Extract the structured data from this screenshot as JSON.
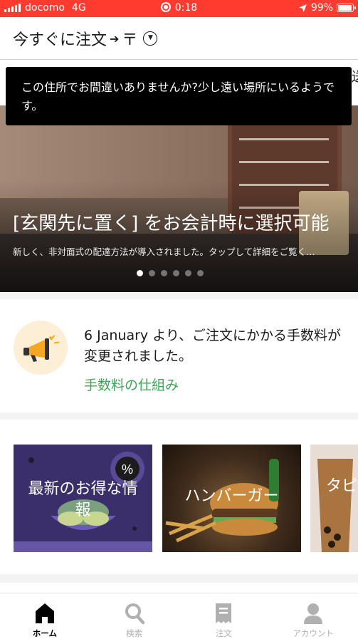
{
  "status_bar": {
    "carrier": "docomo",
    "network": "4G",
    "time": "0:18",
    "battery_percent": "99%",
    "battery_level": 0.99,
    "color": "#ff3b30"
  },
  "header": {
    "order_timing": "今すぐに注文",
    "address_initial": "〒",
    "dropdown_icon": "chevron-down-icon"
  },
  "tooltip": {
    "message": "この住所でお間違いありませんか?少し遠い場所にいるようです。",
    "partial_text_edge": "送"
  },
  "hero": {
    "title": "[玄関先に置く] をお会計時に選択可能",
    "subtitle": "新しく、非対面式の配達方法が導入されました。タップして詳細をご覧く…",
    "slide_count": 6,
    "active_slide": 1
  },
  "notice": {
    "icon": "megaphone-icon",
    "text": "6 January より、ご注文にかかる手数料が変更されました。",
    "link": "手数料の仕組み",
    "link_color": "#3aa757"
  },
  "categories": [
    {
      "label": "最新のお得な情報"
    },
    {
      "label": "ハンバーガー"
    },
    {
      "label": "タピ"
    }
  ],
  "tabbar": {
    "items": [
      {
        "label": "ホーム",
        "icon": "home-icon",
        "active": true
      },
      {
        "label": "検索",
        "icon": "search-icon",
        "active": false
      },
      {
        "label": "注文",
        "icon": "receipt-icon",
        "active": false
      },
      {
        "label": "アカウント",
        "icon": "account-icon",
        "active": false
      }
    ]
  }
}
